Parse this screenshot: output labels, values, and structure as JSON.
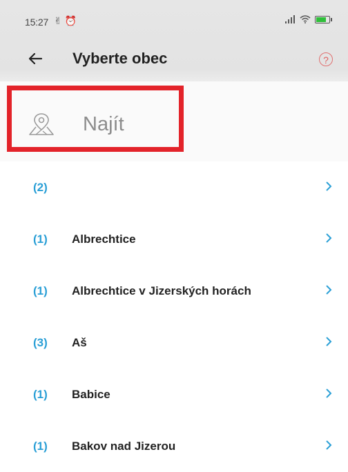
{
  "status_bar": {
    "time": "15:27"
  },
  "header": {
    "title": "Vyberte obec",
    "help_glyph": "?"
  },
  "search": {
    "placeholder": "Najít"
  },
  "colors": {
    "accent": "#2a9fd6",
    "highlight": "#e3232a",
    "help": "#e06060"
  },
  "municipalities": [
    {
      "count": "(2)",
      "name": ""
    },
    {
      "count": "(1)",
      "name": "Albrechtice"
    },
    {
      "count": "(1)",
      "name": "Albrechtice v Jizerských horách"
    },
    {
      "count": "(3)",
      "name": "Aš"
    },
    {
      "count": "(1)",
      "name": "Babice"
    },
    {
      "count": "(1)",
      "name": "Bakov nad Jizerou"
    }
  ]
}
